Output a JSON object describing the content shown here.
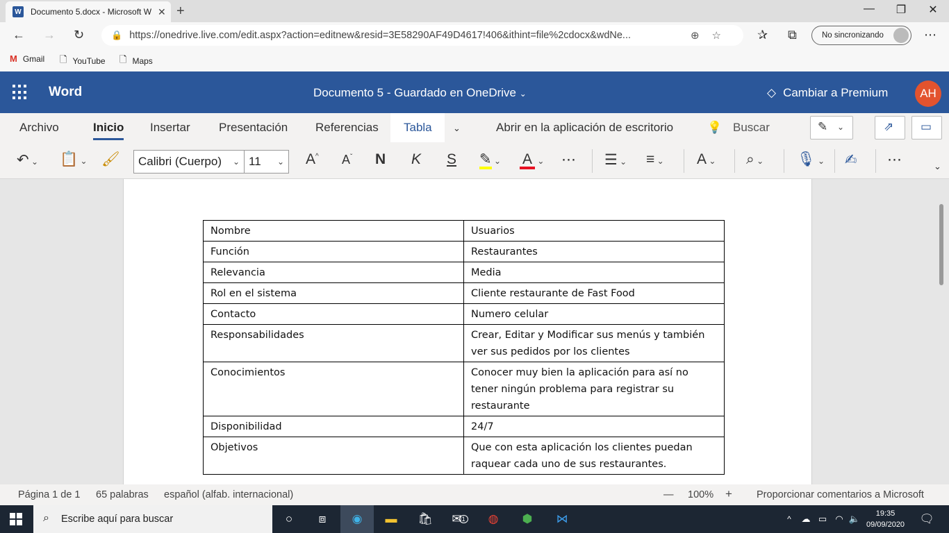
{
  "browser": {
    "tab_title": "Documento 5.docx - Microsoft W",
    "url": "https://onedrive.live.com/edit.aspx?action=editnew&resid=3E58290AF49D4617!406&ithint=file%2cdocx&wdNe...",
    "sync_label": "No sincronizando",
    "bookmarks": [
      "Gmail",
      "YouTube",
      "Maps"
    ]
  },
  "word": {
    "app_name": "Word",
    "doc_title": "Documento 5  -  Guardado en OneDrive",
    "premium_label": "Cambiar a Premium",
    "avatar_initials": "AH",
    "ribbon_tabs": [
      "Archivo",
      "Inicio",
      "Insertar",
      "Presentación",
      "Referencias",
      "Tabla"
    ],
    "open_desktop": "Abrir en la aplicación de escritorio",
    "search_label": "Buscar",
    "font_name": "Calibri (Cuerpo)",
    "font_size": "11",
    "bold_glyph": "N",
    "italic_glyph": "K",
    "strike_glyph": "S",
    "highlight_color": "#ffff00",
    "font_color": "#e81123",
    "accent_color": "#2b579a"
  },
  "table": [
    [
      "Nombre",
      "Usuarios"
    ],
    [
      "Función",
      "Restaurantes"
    ],
    [
      "Relevancia",
      "Media"
    ],
    [
      "Rol en el sistema",
      "Cliente restaurante de Fast Food"
    ],
    [
      "Contacto",
      "Numero celular"
    ],
    [
      "Responsabilidades",
      "Crear, Editar y Modificar sus menús y también ver sus pedidos por los clientes"
    ],
    [
      "Conocimientos",
      "Conocer muy bien la aplicación para así no tener ningún problema para registrar su restaurante"
    ],
    [
      "Disponibilidad",
      "24/7"
    ],
    [
      "Objetivos",
      "Que con esta aplicación los clientes puedan raquear cada uno de sus restaurantes."
    ]
  ],
  "status": {
    "page": "Página 1 de 1",
    "words": "65 palabras",
    "language": "español (alfab. internacional)",
    "zoom": "100%",
    "feedback": "Proporcionar comentarios a Microsoft"
  },
  "taskbar": {
    "search_placeholder": "Escribe aquí para buscar",
    "time": "19:35",
    "date": "09/09/2020",
    "mail_badge": "1"
  }
}
